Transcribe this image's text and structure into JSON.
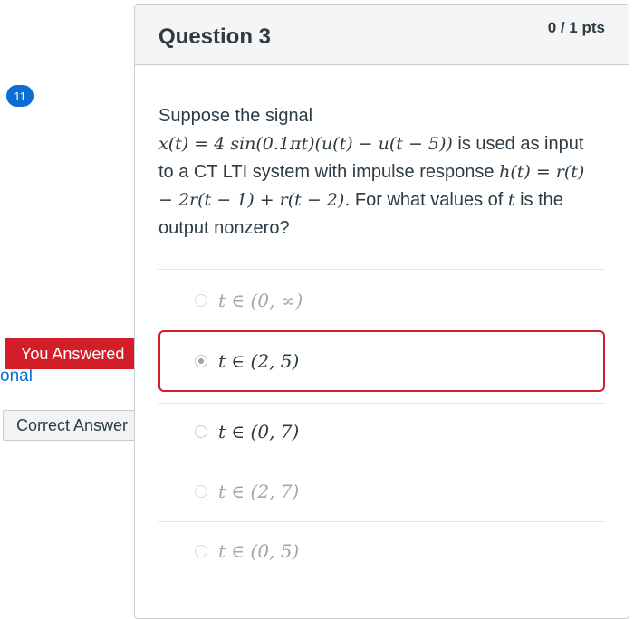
{
  "sidebar": {
    "badge_count": "11",
    "link_fragment": "onal"
  },
  "tags": {
    "you_answered": "You Answered",
    "correct_answer": "Correct Answer"
  },
  "question": {
    "title": "Question 3",
    "points": "0 / 1 pts",
    "text_intro": "Suppose the signal",
    "signal_expr": "x(t) = 4 sin(0.1πt)(u(t) − u(t − 5))",
    "text_mid1": "is used as input to a CT LTI system with impulse response",
    "impulse_expr": "h(t) = r(t) − 2r(t − 1) + r(t − 2).",
    "text_mid2": "For what values of",
    "var_t": "t",
    "text_end": "is the output nonzero?"
  },
  "answers": [
    {
      "label": "t ∈ (0, ∞)",
      "state": "muted"
    },
    {
      "label": "t ∈ (2, 5)",
      "state": "you_answered_wrong"
    },
    {
      "label": "t ∈ (0, 7)",
      "state": "correct"
    },
    {
      "label": "t ∈ (2, 7)",
      "state": "muted"
    },
    {
      "label": "t ∈ (0, 5)",
      "state": "muted"
    }
  ],
  "colors": {
    "accent_blue": "#0b6ed0",
    "wrong_red": "#d21e28",
    "text": "#2d3b45"
  }
}
